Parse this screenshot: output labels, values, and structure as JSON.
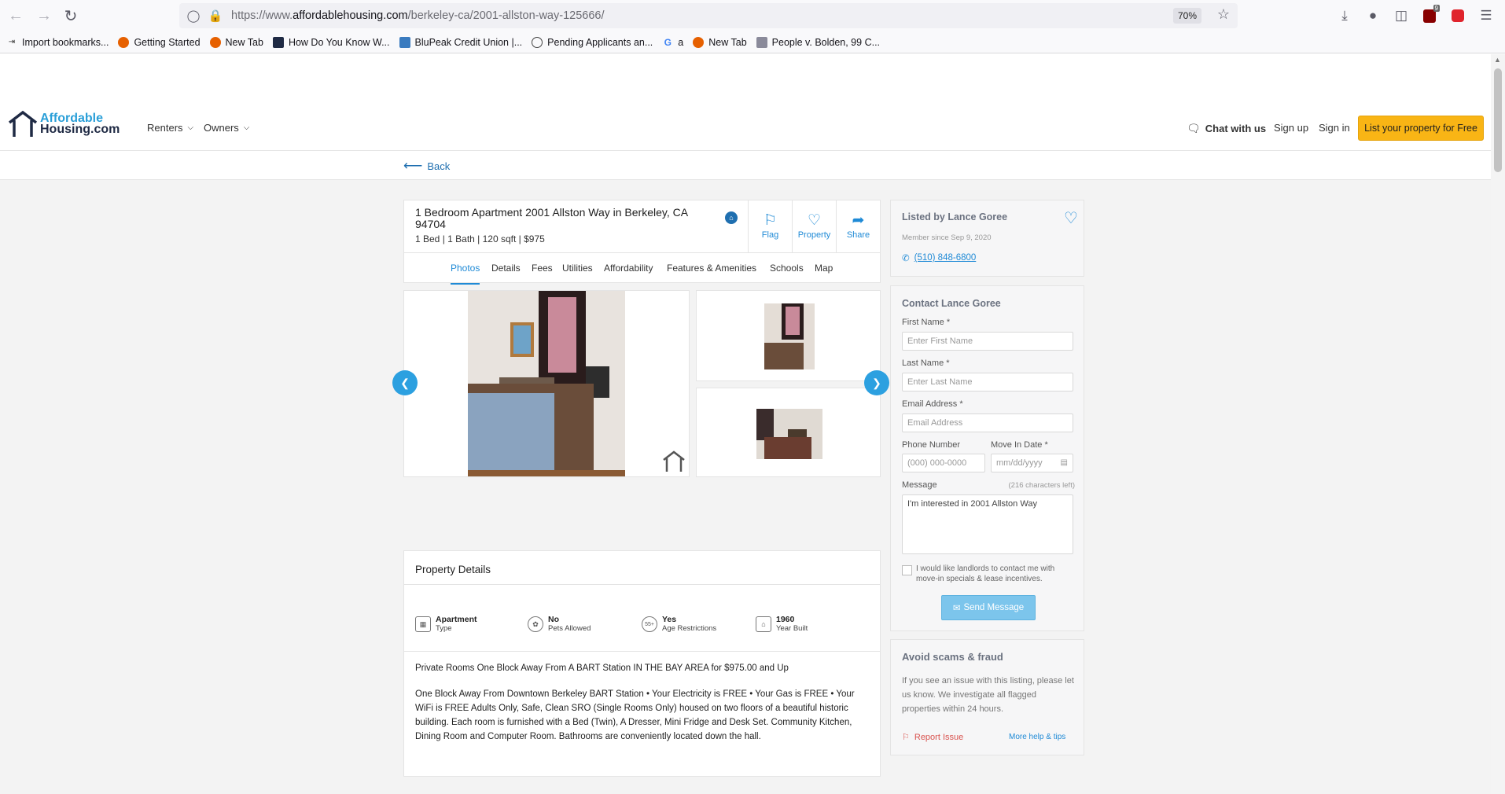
{
  "browser": {
    "url_prefix": "https://www.",
    "url_domain": "affordablehousing.com",
    "url_path": "/berkeley-ca/2001-allston-way-125666/",
    "zoom": "70%",
    "ext_badge": "9",
    "bookmarks": [
      {
        "label": "Import bookmarks...",
        "icon": "import-icon"
      },
      {
        "label": "Getting Started",
        "icon": "firefox-icon"
      },
      {
        "label": "New Tab",
        "icon": "firefox-icon"
      },
      {
        "label": "How Do You Know W...",
        "icon": "site-icon"
      },
      {
        "label": "BluPeak Credit Union |...",
        "icon": "site-icon"
      },
      {
        "label": "Pending Applicants an...",
        "icon": "globe-icon"
      },
      {
        "label": "a",
        "icon": "google-icon"
      },
      {
        "label": "New Tab",
        "icon": "firefox-icon"
      },
      {
        "label": "People v. Bolden, 99 C...",
        "icon": "site-icon"
      }
    ]
  },
  "header": {
    "logo_line1": "Affordable",
    "logo_line2": "Housing.com",
    "nav_renters": "Renters",
    "nav_owners": "Owners",
    "chat": "Chat with us",
    "signup": "Sign up",
    "signin": "Sign in",
    "list_property": "List your property for Free",
    "back": "Back"
  },
  "listing": {
    "title": "1 Bedroom Apartment 2001 Allston Way in Berkeley, CA 94704",
    "meta": "1 Bed  | 1 Bath  | 120  sqft  | $975",
    "actions": {
      "flag": "Flag",
      "property": "Property",
      "share": "Share"
    },
    "tabs": [
      "Photos",
      "Details",
      "Fees",
      "Utilities",
      "Affordability",
      "Features & Amenities",
      "Schools",
      "Map"
    ],
    "active_tab": "Photos"
  },
  "details": {
    "heading": "Property Details",
    "features": [
      {
        "value": "Apartment",
        "label": "Type",
        "icon": "building-icon"
      },
      {
        "value": "No",
        "label": "Pets Allowed",
        "icon": "paw-icon"
      },
      {
        "value": "Yes",
        "label": "Age Restrictions",
        "icon": "age-55-icon"
      },
      {
        "value": "1960",
        "label": "Year Built",
        "icon": "house-icon"
      }
    ],
    "summary": "Private Rooms One Block Away From A BART Station IN THE BAY AREA for $975.00 and Up",
    "description": "One Block Away From Downtown Berkeley BART Station • Your Electricity is FREE • Your Gas is FREE • Your WiFi is FREE Adults Only, Safe, Clean SRO (Single Rooms Only) housed on two floors of a beautiful historic building. Each room is furnished with a Bed (Twin), A Dresser, Mini Fridge and Desk Set. Community Kitchen, Dining Room and Computer Room. Bathrooms are conveniently located down the hall."
  },
  "lister": {
    "heading": "Listed by Lance Goree",
    "member_since": "Member since Sep 9, 2020",
    "phone": "(510) 848-6800"
  },
  "contact": {
    "heading": "Contact Lance Goree",
    "first_name_label": "First Name *",
    "first_name_placeholder": "Enter First Name",
    "last_name_label": "Last Name *",
    "last_name_placeholder": "Enter Last Name",
    "email_label": "Email Address *",
    "email_placeholder": "Email Address",
    "phone_label": "Phone Number",
    "phone_placeholder": "(000) 000-0000",
    "move_label": "Move In Date *",
    "move_placeholder": "mm/dd/yyyy",
    "message_label": "Message",
    "chars_left": "(216 characters left)",
    "message_value": "I'm interested in 2001 Allston Way",
    "consent": "I would like landlords to contact me with move-in specials & lease incentives.",
    "send": "Send Message"
  },
  "scams": {
    "heading": "Avoid scams & fraud",
    "text": "If you see an issue with this listing, please let us know. We investigate all flagged properties within 24 hours.",
    "report": "Report Issue",
    "more": "More help & tips"
  },
  "colors": {
    "accent": "#1f8ad6",
    "brand_yellow": "#f9b515",
    "logo_blue": "#2a9fd8"
  }
}
